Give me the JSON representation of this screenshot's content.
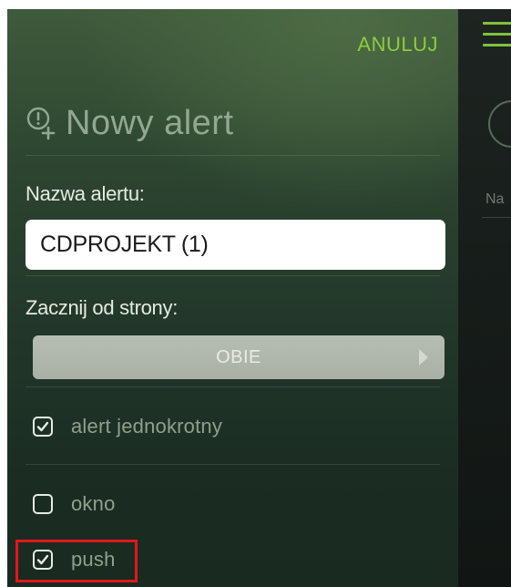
{
  "header": {
    "cancel_label": "ANULUJ",
    "title": "Nowy alert",
    "title_icon": "add-alert-icon"
  },
  "form": {
    "name_label": "Nazwa alertu:",
    "name_value": "CDPROJEKT (1)",
    "side_label": "Zacznij od strony:",
    "side_value": "OBIE"
  },
  "options": [
    {
      "label": "alert jednokrotny",
      "checked": true
    },
    {
      "label": "okno",
      "checked": false
    },
    {
      "label": "push",
      "checked": true
    }
  ],
  "background_view": {
    "label_fragment": "Na"
  },
  "colors": {
    "accent": "#8ccc3e",
    "highlight": "#e3161b"
  }
}
